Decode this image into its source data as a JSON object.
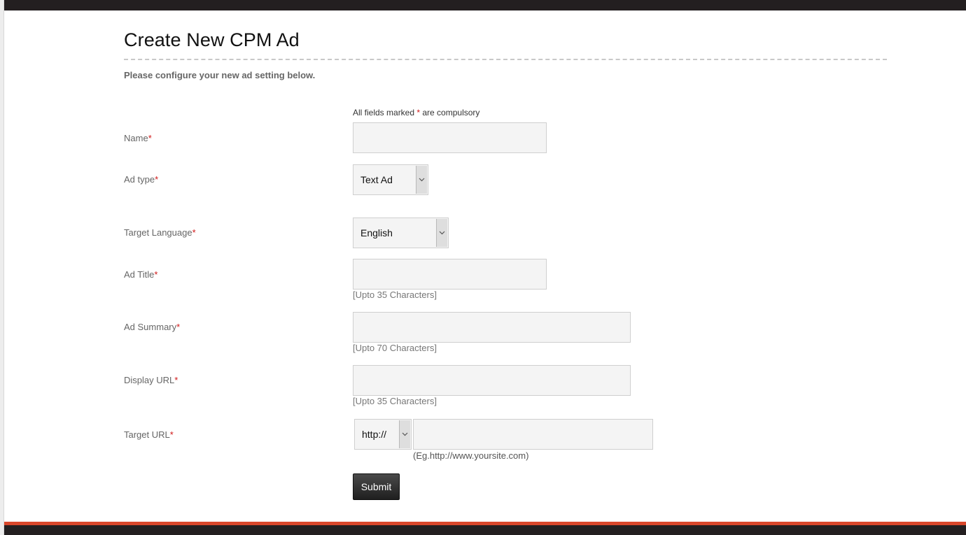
{
  "header": {
    "title": "Create New CPM Ad",
    "subtitle": "Please configure your new ad setting below."
  },
  "form": {
    "note_before": "All fields marked ",
    "note_star": "*",
    "note_after": " are compulsory",
    "required_marker": "*",
    "fields": {
      "name": {
        "label": "Name",
        "value": ""
      },
      "ad_type": {
        "label": "Ad type",
        "selected": "Text Ad"
      },
      "target_language": {
        "label": "Target Language",
        "selected": "English"
      },
      "ad_title": {
        "label": "Ad Title",
        "value": "",
        "hint": "[Upto 35 Characters]"
      },
      "ad_summary": {
        "label": "Ad Summary",
        "value": "",
        "hint": "[Upto 70 Characters]"
      },
      "display_url": {
        "label": "Display URL",
        "value": "",
        "hint": "[Upto 35 Characters]"
      },
      "target_url": {
        "label": "Target URL",
        "protocol": "http://",
        "value": "",
        "hint": "(Eg.http://www.yoursite.com)"
      }
    },
    "submit_label": "Submit"
  },
  "icons": {
    "dropdown": "chevron-down-icon"
  },
  "colors": {
    "required": "#d01818",
    "bottom_accent": "#d9472b",
    "bar_dark": "#231f20"
  }
}
